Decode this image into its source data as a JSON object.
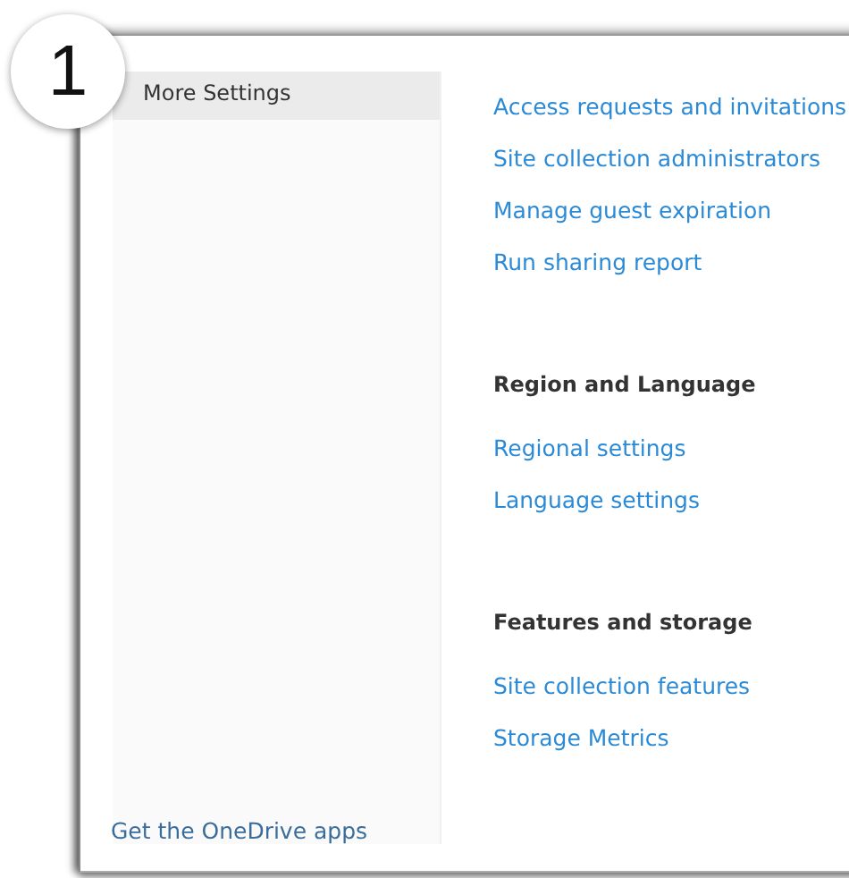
{
  "step_badge": "1",
  "sidebar": {
    "items": [
      {
        "label": "More Settings",
        "selected": true
      }
    ],
    "footer_link": "Get the OneDrive apps"
  },
  "sections": [
    {
      "links": [
        "Access requests and invitations",
        "Site collection administrators",
        "Manage guest expiration",
        "Run sharing report"
      ]
    },
    {
      "heading": "Region and Language",
      "links": [
        "Regional settings",
        "Language settings"
      ]
    },
    {
      "heading": "Features and storage",
      "links": [
        "Site collection features",
        "Storage Metrics"
      ]
    }
  ]
}
